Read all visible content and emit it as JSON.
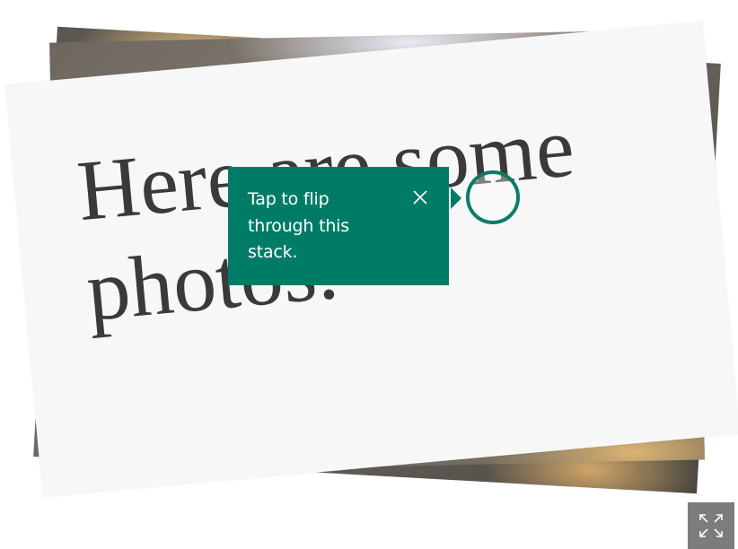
{
  "stack": {
    "title": "Here are some photos."
  },
  "coachmark": {
    "text": "Tap to flip through this stack.",
    "close_icon": "close-icon",
    "accent_color": "#007c66"
  },
  "expand": {
    "icon": "expand-icon"
  }
}
